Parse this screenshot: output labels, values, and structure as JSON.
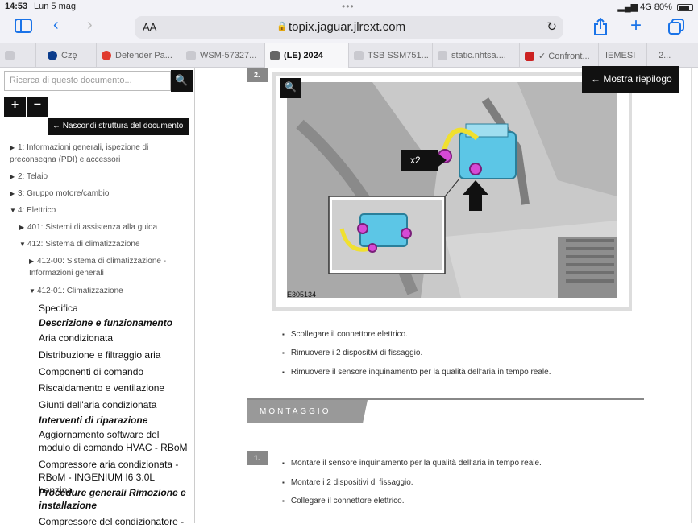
{
  "status": {
    "time": "14:53",
    "date": "Lun 5 mag",
    "network": "4G",
    "battery": "80%"
  },
  "browser": {
    "text_size": "AA",
    "url": "topix.jaguar.jlrext.com",
    "tabs": [
      {
        "label": "Czę"
      },
      {
        "label": "Defender Pa..."
      },
      {
        "label": "WSM-57327..."
      },
      {
        "label": "(LE) 2024"
      },
      {
        "label": "TSB SSM751..."
      },
      {
        "label": "static.nhtsa...."
      },
      {
        "label": "Confront..."
      },
      {
        "label": "IEMESI"
      },
      {
        "label": "2..."
      }
    ]
  },
  "sidebar": {
    "search_placeholder": "Ricerca di questo documento...",
    "hide_structure": "←  Nascondi struttura del documento",
    "tree": [
      {
        "label": "1: Informazioni generali, ispezione di preconsegna (PDI) e accessori"
      },
      {
        "label": "2: Telaio"
      },
      {
        "label": "3: Gruppo motore/cambio"
      },
      {
        "label": "4: Elettrico"
      },
      {
        "label": "401: Sistemi di assistenza alla guida"
      },
      {
        "label": "412: Sistema di climatizzazione"
      },
      {
        "label": "412-00: Sistema di climatizzazione - Informazioni generali"
      },
      {
        "label": "412-01: Climatizzazione"
      }
    ],
    "leaves": [
      "Specifica",
      "Descrizione e funzionamento",
      "Aria condizionata",
      "Distribuzione e filtraggio aria",
      "Componenti di comando",
      "Riscaldamento e ventilazione",
      "Giunti dell'aria condizionata",
      "Interventi di riparazione",
      "Aggiornamento software del modulo di comando HVAC - RBoM",
      "Compressore aria condizionata - RBoM - INGENIUM I6 3.0L benzina",
      "Procedure generali Rimozione e installazione",
      "Compressore del condizionatore -"
    ]
  },
  "content": {
    "step2": "2.",
    "summary_button": "←  Mostra riepilogo",
    "figure_label": "E305134",
    "callout": "x2",
    "bullets_removal": [
      "Scollegare il connettore elettrico.",
      "Rimuovere i 2 dispositivi di fissaggio.",
      "Rimuovere il sensore inquinamento per la qualità dell'aria in tempo reale."
    ],
    "section_title": "MONTAGGIO",
    "step1": "1.",
    "bullets_install": [
      "Montare il sensore inquinamento per la qualità dell'aria in tempo reale.",
      "Montare i 2 dispositivi di fissaggio.",
      "Collegare il connettore elettrico."
    ]
  }
}
